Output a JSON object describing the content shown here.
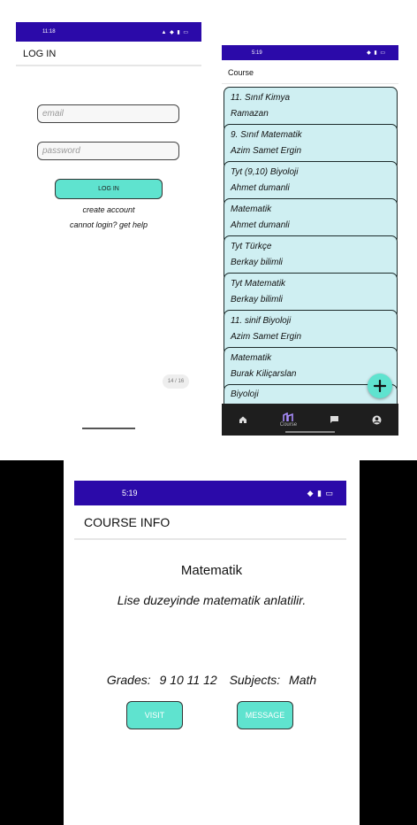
{
  "login_screen": {
    "status_time": "11:18",
    "status_icons": "⚙ ⫶ ꞉ 🔋",
    "title": "LOG IN",
    "email_placeholder": "email",
    "password_placeholder": "password",
    "login_button": "LOG IN",
    "create_account": "create account",
    "cannot_login": "cannot login? get help",
    "page_counter": "14 / 16"
  },
  "course_screen": {
    "status_time": "5:19",
    "status_icons": "⫶ ꞉ ⫶",
    "title": "Course",
    "courses": [
      {
        "name": "11. Sınıf Kimya",
        "teacher": "Ramazan"
      },
      {
        "name": "9. Sınıf Matematik",
        "teacher": "Azim Samet Ergin"
      },
      {
        "name": "Tyt (9,10) Biyoloji",
        "teacher": "Ahmet dumanli"
      },
      {
        "name": "Matematik",
        "teacher": "Ahmet dumanli"
      },
      {
        "name": "Tyt Türkçe",
        "teacher": "Berkay bilimli"
      },
      {
        "name": "Tyt Matematik",
        "teacher": "Berkay bilimli"
      },
      {
        "name": "11. sinif Biyoloji",
        "teacher": "Azim Samet Ergin"
      },
      {
        "name": "Matematik",
        "teacher": "Burak Kiliçarslan"
      },
      {
        "name": "Biyoloji",
        "teacher": ""
      }
    ],
    "fab_icon": "plus-icon",
    "nav": {
      "home_icon": "home-icon",
      "course_label": "Course",
      "chat_icon": "chat-icon",
      "profile_icon": "profile-icon"
    }
  },
  "info_screen": {
    "status_time": "5:19",
    "status_icons": "⫶ ꞉ ⫶ 🔋",
    "title": "COURSE INFO",
    "course_name": "Matematik",
    "description": "Lise duzeyinde matematik anlatilir.",
    "grades_label": "Grades:",
    "grades_value": "9 10 11 12",
    "subjects_label": "Subjects:",
    "subjects_value": "Math",
    "visit_button": "VISIT",
    "message_button": "MESSAGE"
  },
  "colors": {
    "statusbar": "#2b0aa9",
    "teal": "#5fe3cf",
    "card": "#cfeff2",
    "navbar": "#1e1e1e"
  }
}
